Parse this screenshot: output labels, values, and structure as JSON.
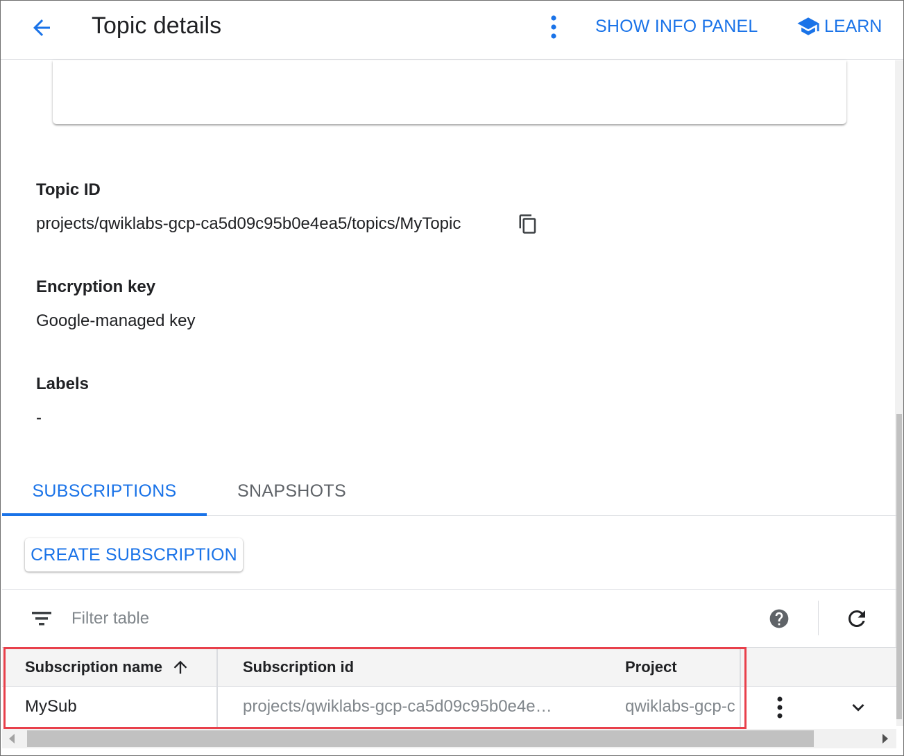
{
  "header": {
    "title": "Topic details",
    "show_info_panel": "SHOW INFO PANEL",
    "learn": "LEARN"
  },
  "details": {
    "topic_id_label": "Topic ID",
    "topic_id_value": "projects/qwiklabs-gcp-ca5d09c95b0e4ea5/topics/MyTopic",
    "encryption_label": "Encryption key",
    "encryption_value": "Google-managed key",
    "labels_label": "Labels",
    "labels_value": "-"
  },
  "tabs": [
    {
      "label": "SUBSCRIPTIONS",
      "active": true
    },
    {
      "label": "SNAPSHOTS",
      "active": false
    }
  ],
  "create_button": "CREATE SUBSCRIPTION",
  "filter": {
    "placeholder": "Filter table",
    "value": ""
  },
  "table": {
    "columns": [
      "Subscription name",
      "Subscription id",
      "Project"
    ],
    "sort_column": "Subscription name",
    "sort_direction": "ascending",
    "rows": [
      {
        "name": "MySub",
        "id": "projects/qwiklabs-gcp-ca5d09c95b0e4e…",
        "project": "qwiklabs-gcp-c"
      }
    ]
  },
  "icons": {
    "back": "arrow-back-icon",
    "more": "more-vert-icon",
    "learn": "school-icon",
    "copy": "copy-icon",
    "filter": "filter-list-icon",
    "help": "help-icon",
    "refresh": "refresh-icon",
    "sort": "arrow-upward-icon",
    "expand": "chevron-down-icon"
  },
  "colors": {
    "accent": "#1a73e8",
    "highlight": "#e8404b",
    "text": "#202124",
    "muted": "#80868b"
  }
}
